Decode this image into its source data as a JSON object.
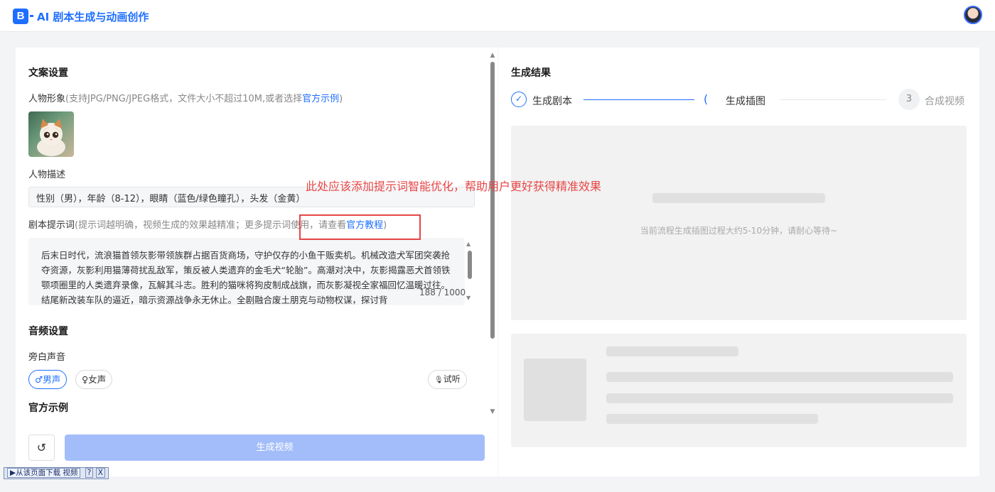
{
  "header": {
    "logo_text": "B",
    "title": "AI 剧本生成与动画创作"
  },
  "left": {
    "copy_settings_title": "文案设置",
    "character": {
      "label": "人物形象",
      "hint_prefix": "(支持JPG/PNG/JPEG格式，文件大小不超过10M,或者选择",
      "hint_link": "官方示例",
      "hint_suffix": ")"
    },
    "description": {
      "label": "人物描述",
      "value": "性别（男），年龄（8-12），眼睛（蓝色/绿色瞳孔），头发（金黄）"
    },
    "script_prompt": {
      "label": "剧本提示词",
      "hint_prefix": "(提示词越明确，视频生成的效果越精准；更多提示词使用，请查看",
      "hint_link": "官方教程",
      "hint_suffix": ")",
      "value": "后末日时代，流浪猫首领灰影带领族群占据百货商场，守护仅存的小鱼干贩卖机。机械改造犬军团突袭抢夺资源，灰影利用猫薄荷扰乱敌军，策反被人类遗弃的金毛犬“轮胎”。高潮对决中，灰影揭露恶犬首领铁颚项圈里的人类遗弃录像，瓦解其斗志。胜利的猫咪将狗皮制成战旗，而灰影凝视全家福回忆温暖过往。结尾新改装车队的逼近，暗示资源战争永无休止。全剧融合废土朋克与动物权谋，探讨背",
      "count": "188 / 1000"
    },
    "audio_title": "音频设置",
    "narration_label": "旁白声音",
    "voices": {
      "male": "男声",
      "female": "女声",
      "listen": "试听",
      "male_icon": "♂",
      "female_icon": "♀",
      "mic_icon": "🎙"
    },
    "official_title": "官方示例",
    "reset_icon": "↺",
    "generate_button": "生成视频"
  },
  "right": {
    "title": "生成结果",
    "steps": [
      {
        "label": "生成剧本",
        "state": "done",
        "icon": "✓"
      },
      {
        "label": "生成插图",
        "state": "active",
        "icon": "("
      },
      {
        "label": "合成视频",
        "state": "pending",
        "icon": "3"
      }
    ],
    "waiting_text": "当前流程生成插图过程大约5-10分钟，请耐心等待~"
  },
  "annotation": {
    "text": "此处应该添加提示词智能优化，帮助用户更好获得精准效果"
  },
  "download_bar": {
    "text": "▶从该页面下载 视频",
    "help": "?",
    "close": "X"
  },
  "colors": {
    "accent": "#1f6fff",
    "annotation": "#e84545",
    "button_disabled": "#a3bdfa"
  }
}
